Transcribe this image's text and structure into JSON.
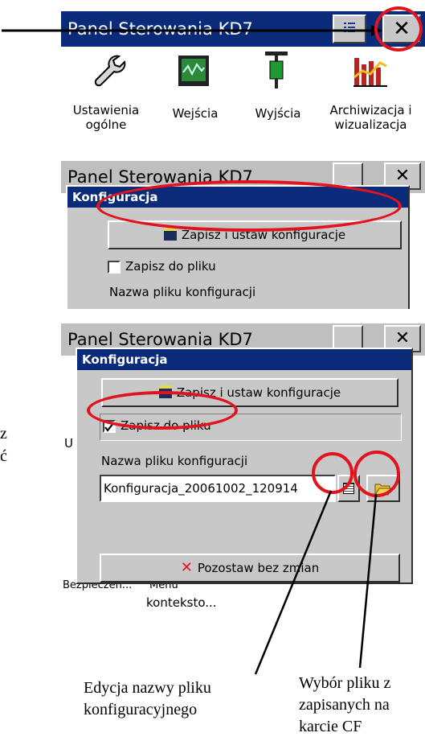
{
  "screen1": {
    "title": "Panel Sterowania KD7",
    "close_glyph": "✕",
    "icons": [
      {
        "label": "Ustawienia ogólne",
        "icon": "wrench-icon"
      },
      {
        "label": "Wejścia",
        "icon": "input-chart-icon"
      },
      {
        "label": "Wyjścia",
        "icon": "output-plug-icon"
      },
      {
        "label": "Archiwizacja i wizualizacja",
        "icon": "bar-chart-icon"
      }
    ]
  },
  "screen2": {
    "title": "Panel Sterowania KD7",
    "dialog_title": "Konfiguracja",
    "save_button": "Zapisz i ustaw konfiguracje",
    "checkbox_label": "Zapisz do pliku",
    "filename_label": "Nazwa pliku konfiguracji"
  },
  "screen3": {
    "title": "Panel Sterowania KD7",
    "dialog_title": "Konfiguracja",
    "save_button": "Zapisz i ustaw konfiguracje",
    "checkbox_label": "Zapisz do pliku",
    "filename_label": "Nazwa pliku konfiguracji",
    "filename_value": "Konfiguracja_20061002_120914",
    "cancel_button": "Pozostaw bez zmian",
    "behind_left": "Bezpieczeń...",
    "behind_right": "Menu",
    "behind_bottom": "konteksto...",
    "behind_u": "U"
  },
  "side_fragments": {
    "z": "z",
    "c": "ć"
  },
  "annotations": {
    "edit_name": "Edycja nazwy pliku konfiguracyjnego",
    "choose_file": "Wybór pliku z zapisanych na karcie CF"
  },
  "colors": {
    "titlebar": "#0a2a7a",
    "highlight": "#e0141e",
    "face": "#c8c8c8"
  }
}
